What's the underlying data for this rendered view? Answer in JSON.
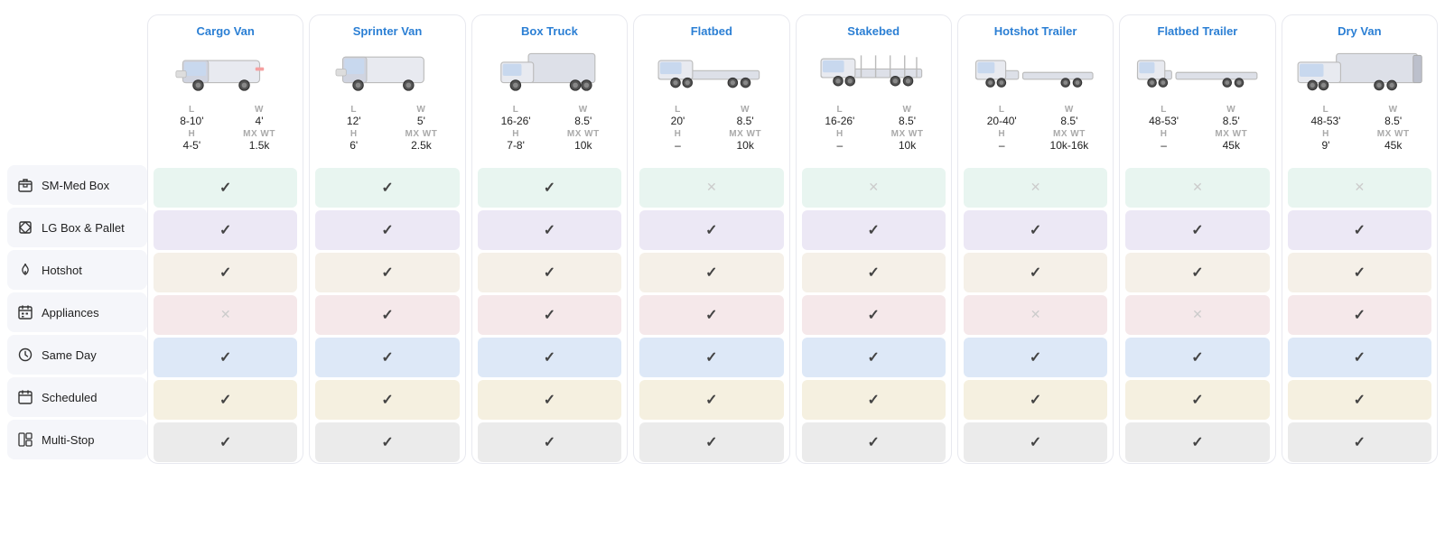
{
  "sidebar": {
    "items": [
      {
        "id": "sm-med-box",
        "label": "SM-Med Box",
        "icon": "box"
      },
      {
        "id": "lg-box-pallet",
        "label": "LG Box & Pallet",
        "icon": "diamond-box"
      },
      {
        "id": "hotshot",
        "label": "Hotshot",
        "icon": "flame"
      },
      {
        "id": "appliances",
        "label": "Appliances",
        "icon": "calendar-grid"
      },
      {
        "id": "same-day",
        "label": "Same Day",
        "icon": "clock"
      },
      {
        "id": "scheduled",
        "label": "Scheduled",
        "icon": "calendar"
      },
      {
        "id": "multi-stop",
        "label": "Multi-Stop",
        "icon": "grid"
      }
    ]
  },
  "vehicles": [
    {
      "id": "cargo-van",
      "title": "Cargo Van",
      "specs": {
        "L": "8-10'",
        "W": "4'",
        "H": "4-5'",
        "MX_WT": "1.5k"
      },
      "cells": [
        true,
        true,
        true,
        false,
        true,
        true,
        true
      ]
    },
    {
      "id": "sprinter-van",
      "title": "Sprinter Van",
      "specs": {
        "L": "12'",
        "W": "5'",
        "H": "6'",
        "MX_WT": "2.5k"
      },
      "cells": [
        true,
        true,
        true,
        true,
        true,
        true,
        true
      ]
    },
    {
      "id": "box-truck",
      "title": "Box Truck",
      "specs": {
        "L": "16-26'",
        "W": "8.5'",
        "H": "7-8'",
        "MX_WT": "10k"
      },
      "cells": [
        true,
        true,
        true,
        true,
        true,
        true,
        true
      ]
    },
    {
      "id": "flatbed",
      "title": "Flatbed",
      "specs": {
        "L": "20'",
        "W": "8.5'",
        "H": "–",
        "MX_WT": "10k"
      },
      "cells": [
        false,
        true,
        true,
        true,
        true,
        true,
        true
      ]
    },
    {
      "id": "stakebed",
      "title": "Stakebed",
      "specs": {
        "L": "16-26'",
        "W": "8.5'",
        "H": "–",
        "MX_WT": "10k"
      },
      "cells": [
        false,
        true,
        true,
        true,
        true,
        true,
        true
      ]
    },
    {
      "id": "hotshot-trailer",
      "title": "Hotshot Trailer",
      "specs": {
        "L": "20-40'",
        "W": "8.5'",
        "H": "–",
        "MX_WT": "10k-16k"
      },
      "cells": [
        false,
        true,
        true,
        false,
        true,
        true,
        true
      ]
    },
    {
      "id": "flatbed-trailer",
      "title": "Flatbed Trailer",
      "specs": {
        "L": "48-53'",
        "W": "8.5'",
        "H": "–",
        "MX_WT": "45k"
      },
      "cells": [
        false,
        true,
        true,
        false,
        true,
        true,
        true
      ]
    },
    {
      "id": "dry-van",
      "title": "Dry Van",
      "specs": {
        "L": "48-53'",
        "W": "8.5'",
        "H": "9'",
        "MX_WT": "45k"
      },
      "cells": [
        false,
        true,
        true,
        true,
        true,
        true,
        true
      ]
    }
  ],
  "row_colors": [
    "#e8f5f0",
    "#ece8f5",
    "#f5f0e8",
    "#f5e8ea",
    "#dde8f7",
    "#f5f0e0",
    "#ebebeb"
  ],
  "check_symbol": "✓",
  "cross_symbol": "✕"
}
